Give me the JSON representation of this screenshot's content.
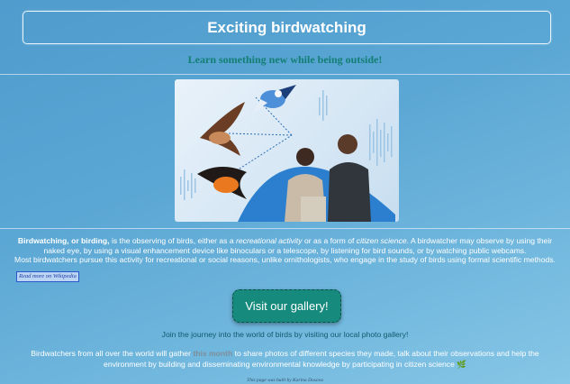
{
  "header": {
    "title": "Exciting birdwatching",
    "subtitle": "Learn something new while being outside!"
  },
  "hero": {
    "icon": "birdwatching-illustration"
  },
  "description": {
    "term": "Birdwatching, or birding,",
    "part1": " is the observing of birds, either as a ",
    "activity": "recreational activity",
    "part2": " or as a form of ",
    "science": "citizen science",
    "part3": ". A birdwatcher may observe by using their naked eye, by using a visual enhancement device like binoculars or a telescope, by listening for bird sounds, or by watching public webcams.",
    "line2": "Most birdwatchers pursue this activity for recreational or social reasons, unlike ornithologists, who engage in the study of birds using formal scientific methods."
  },
  "wiki_link": "Read more on Wikipedia",
  "gallery_button": "Visit our gallery!",
  "journey_text": "Join the journey into the world of birds by visiting our local photo gallery!",
  "birdwatchers": {
    "part1": "Birdwatchers from all over the world will gather ",
    "highlight": "this month",
    "part2": " to share photos of different species they made, talk about their observations and help the environment by building and disseminating environmental knowledge by participating in citizen science ",
    "emoji": "🌿"
  },
  "footer": "This page was built by Karina Dosova",
  "colors": {
    "accent": "#168b7d",
    "subtitle": "#137f74"
  }
}
